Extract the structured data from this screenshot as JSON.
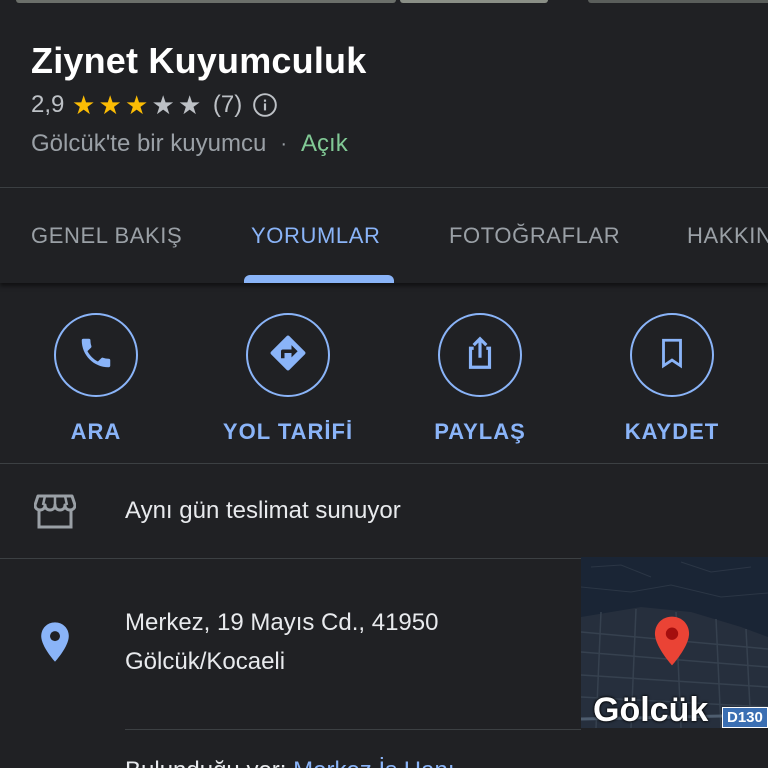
{
  "place": {
    "name": "Ziynet Kuyumculuk",
    "rating": "2,9",
    "rating_value": 2.9,
    "stars_total": 5,
    "stars_filled": 3,
    "review_count": "(7)",
    "category": "Gölcük'te bir kuyumcu",
    "separator": "·",
    "status": "Açık"
  },
  "tabs": [
    {
      "label": "GENEL BAKIŞ",
      "active": false
    },
    {
      "label": "YORUMLAR",
      "active": true
    },
    {
      "label": "FOTOĞRAFLAR",
      "active": false
    },
    {
      "label": "HAKKINDA",
      "active": false
    }
  ],
  "actions": [
    {
      "label": "ARA",
      "icon": "phone-icon"
    },
    {
      "label": "YOL TARİFİ",
      "icon": "directions-icon"
    },
    {
      "label": "PAYLAŞ",
      "icon": "share-icon"
    },
    {
      "label": "KAYDET",
      "icon": "bookmark-icon"
    }
  ],
  "delivery": {
    "icon": "storefront-icon",
    "text": "Aynı gün teslimat sunuyor"
  },
  "address": {
    "icon": "location-pin-icon",
    "line1": "Merkez, 19 Mayıs Cd., 41950",
    "line2": "Gölcük/Kocaeli"
  },
  "map": {
    "city": "Gölcük",
    "road": "D130",
    "pin_color": "#ea4335"
  },
  "next_row": {
    "prefix": "Bulunduğu yer: ",
    "link": "Merkez İş Hanı"
  },
  "colors": {
    "accent": "#8ab4f8",
    "star": "#fbbc04",
    "open": "#81c995",
    "background": "#202124"
  }
}
